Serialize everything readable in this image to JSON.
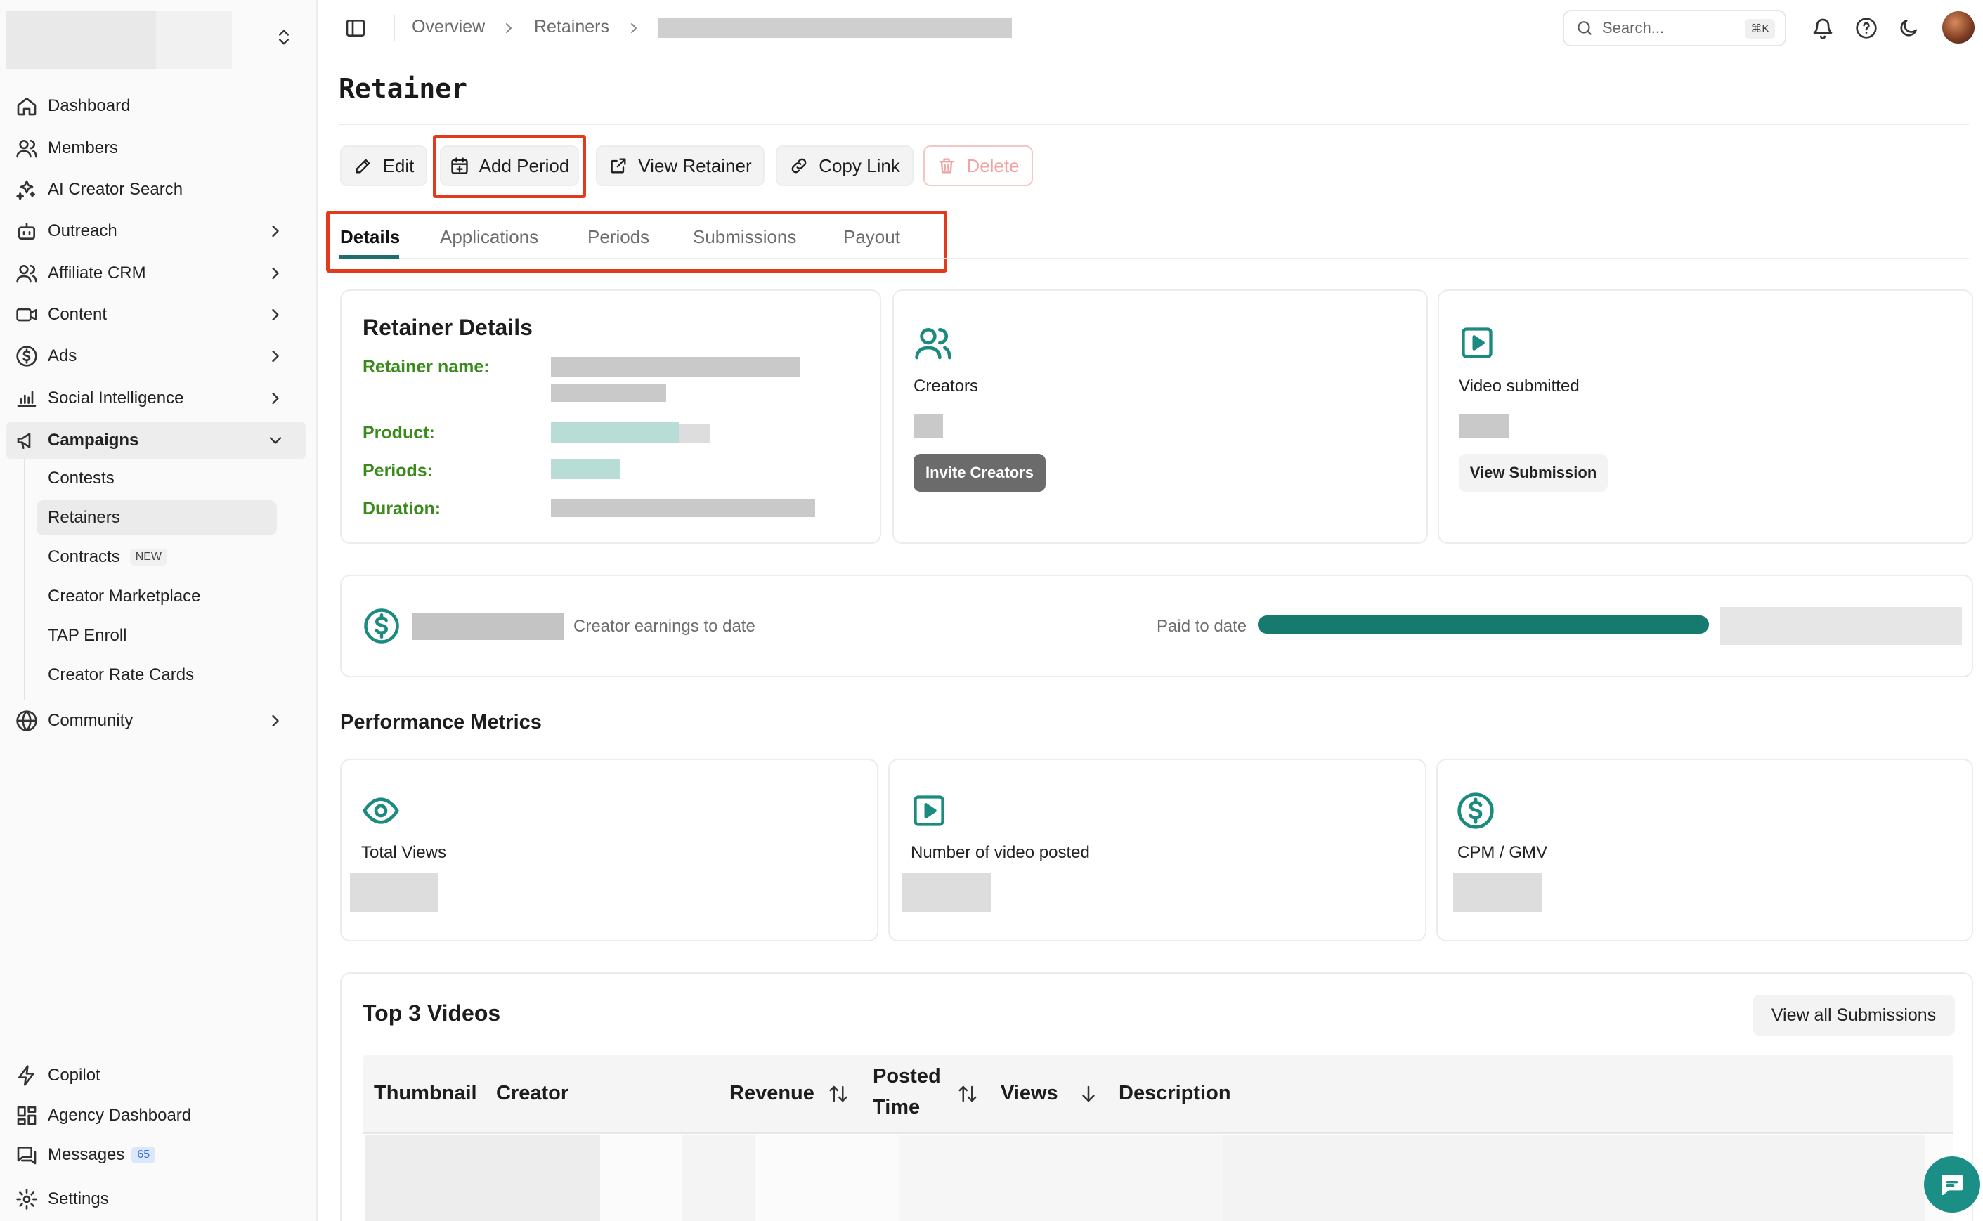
{
  "sidebar": {
    "nav": [
      {
        "label": "Dashboard",
        "icon": "home-icon"
      },
      {
        "label": "Members",
        "icon": "users-icon"
      },
      {
        "label": "AI Creator Search",
        "icon": "sparkles-icon"
      },
      {
        "label": "Outreach",
        "icon": "robot-icon"
      },
      {
        "label": "Affiliate CRM",
        "icon": "users-icon"
      },
      {
        "label": "Content",
        "icon": "video-icon"
      },
      {
        "label": "Ads",
        "icon": "dollar-icon"
      },
      {
        "label": "Social Intelligence",
        "icon": "chart-icon"
      },
      {
        "label": "Campaigns",
        "icon": "megaphone-icon"
      }
    ],
    "campaign_items": [
      {
        "label": "Contests"
      },
      {
        "label": "Retainers"
      },
      {
        "label": "Contracts",
        "badge": "NEW"
      },
      {
        "label": "Creator Marketplace"
      },
      {
        "label": "TAP Enroll"
      },
      {
        "label": "Creator Rate Cards"
      }
    ],
    "community": "Community",
    "bottom": [
      {
        "label": "Copilot",
        "icon": "bolt-icon"
      },
      {
        "label": "Agency Dashboard",
        "icon": "grid-icon"
      },
      {
        "label": "Messages",
        "icon": "message-icon",
        "badge": "65"
      },
      {
        "label": "Settings",
        "icon": "gear-icon"
      }
    ]
  },
  "topbar": {
    "breadcrumb": [
      "Overview",
      "Retainers"
    ],
    "search_placeholder": "Search...",
    "search_shortcut": "⌘K"
  },
  "page": {
    "title": "Retainer",
    "actions": {
      "edit": "Edit",
      "add_period": "Add Period",
      "view_retainer": "View Retainer",
      "copy_link": "Copy Link",
      "delete": "Delete"
    },
    "tabs": [
      "Details",
      "Applications",
      "Periods",
      "Submissions",
      "Payout"
    ],
    "active_tab": "Details"
  },
  "details": {
    "title": "Retainer Details",
    "fields": [
      "Retainer name:",
      "Product:",
      "Periods:",
      "Duration:"
    ]
  },
  "creators_card": {
    "label": "Creators",
    "button": "Invite Creators"
  },
  "video_card": {
    "label": "Video submitted",
    "button": "View Submission"
  },
  "earnings": {
    "label": "Creator earnings to date",
    "paid_label": "Paid to date",
    "paid_fraction": 1.0
  },
  "performance": {
    "title": "Performance Metrics",
    "metrics": [
      {
        "label": "Total Views",
        "icon": "eye-icon"
      },
      {
        "label": "Number of video posted",
        "icon": "video-icon"
      },
      {
        "label": "CPM / GMV",
        "icon": "dollar-icon"
      }
    ]
  },
  "top_videos": {
    "title": "Top 3 Videos",
    "view_all": "View all Submissions",
    "columns": [
      "Thumbnail",
      "Creator",
      "Revenue",
      "Posted",
      "Time",
      "Views",
      "Description"
    ]
  },
  "colors": {
    "accent": "#1a8b7e",
    "highlight_box": "#e33a1e",
    "label_green": "#3a8a1c"
  }
}
